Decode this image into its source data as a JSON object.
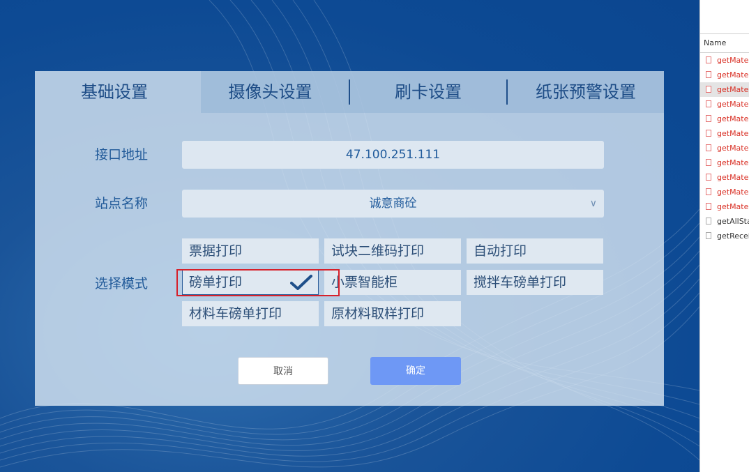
{
  "tabs": [
    {
      "label": "基础设置",
      "active": true
    },
    {
      "label": "摄像头设置",
      "active": false
    },
    {
      "label": "刷卡设置",
      "active": false
    },
    {
      "label": "纸张预警设置",
      "active": false
    }
  ],
  "form": {
    "interface_address": {
      "label": "接口地址",
      "value": "47.100.251.111"
    },
    "site_name": {
      "label": "站点名称",
      "value": "诚意商砼"
    },
    "mode": {
      "label": "选择模式",
      "options": [
        "票据打印",
        "试块二维码打印",
        "自动打印",
        "磅单打印",
        "小票智能柜",
        "搅拌车磅单打印",
        "材料车磅单打印",
        "原材料取样打印"
      ],
      "selected": "磅单打印"
    }
  },
  "buttons": {
    "cancel": "取消",
    "confirm": "确定"
  },
  "colors": {
    "primary_button": "#6e98f5",
    "highlight_border": "#d7202a",
    "background": "#0d4a94"
  },
  "devtools": {
    "column_header": "Name",
    "requests": [
      {
        "name": "getMate",
        "status": "error"
      },
      {
        "name": "getMate",
        "status": "error"
      },
      {
        "name": "getMate",
        "status": "error",
        "selected": true
      },
      {
        "name": "getMate",
        "status": "error"
      },
      {
        "name": "getMate",
        "status": "error"
      },
      {
        "name": "getMate",
        "status": "error"
      },
      {
        "name": "getMate",
        "status": "error"
      },
      {
        "name": "getMate",
        "status": "error"
      },
      {
        "name": "getMate",
        "status": "error"
      },
      {
        "name": "getMate",
        "status": "error"
      },
      {
        "name": "getMate",
        "status": "error"
      },
      {
        "name": "getAllSta",
        "status": "ok"
      },
      {
        "name": "getRecei",
        "status": "ok"
      }
    ]
  }
}
